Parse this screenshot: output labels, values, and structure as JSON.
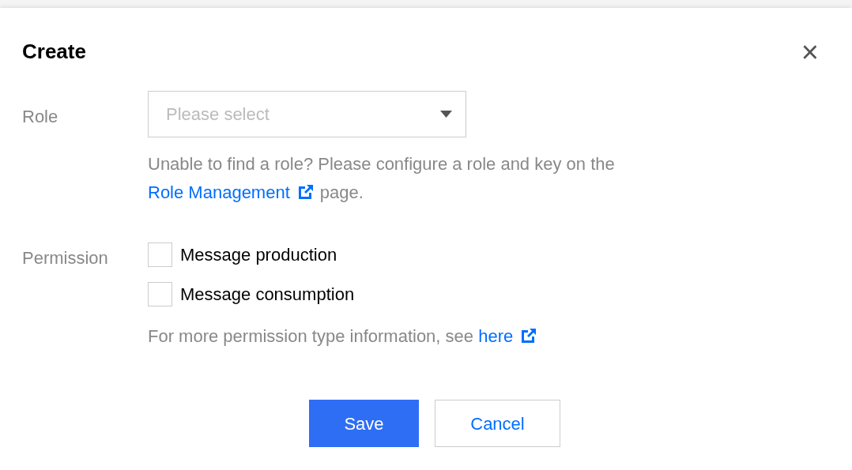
{
  "dialog": {
    "title": "Create",
    "close": "×"
  },
  "role": {
    "label": "Role",
    "placeholder": "Please select",
    "help": {
      "before": "Unable to find a role? Please configure a role and key on the",
      "link": "Role Management",
      "after": "page."
    }
  },
  "permission": {
    "label": "Permission",
    "options": [
      {
        "label": "Message production",
        "checked": false
      },
      {
        "label": "Message consumption",
        "checked": false
      }
    ],
    "help": {
      "before": "For more permission type information, see",
      "link": "here"
    }
  },
  "buttons": [
    {
      "label": "Save",
      "kind": "primary"
    },
    {
      "label": "Cancel",
      "kind": "secondary"
    }
  ]
}
